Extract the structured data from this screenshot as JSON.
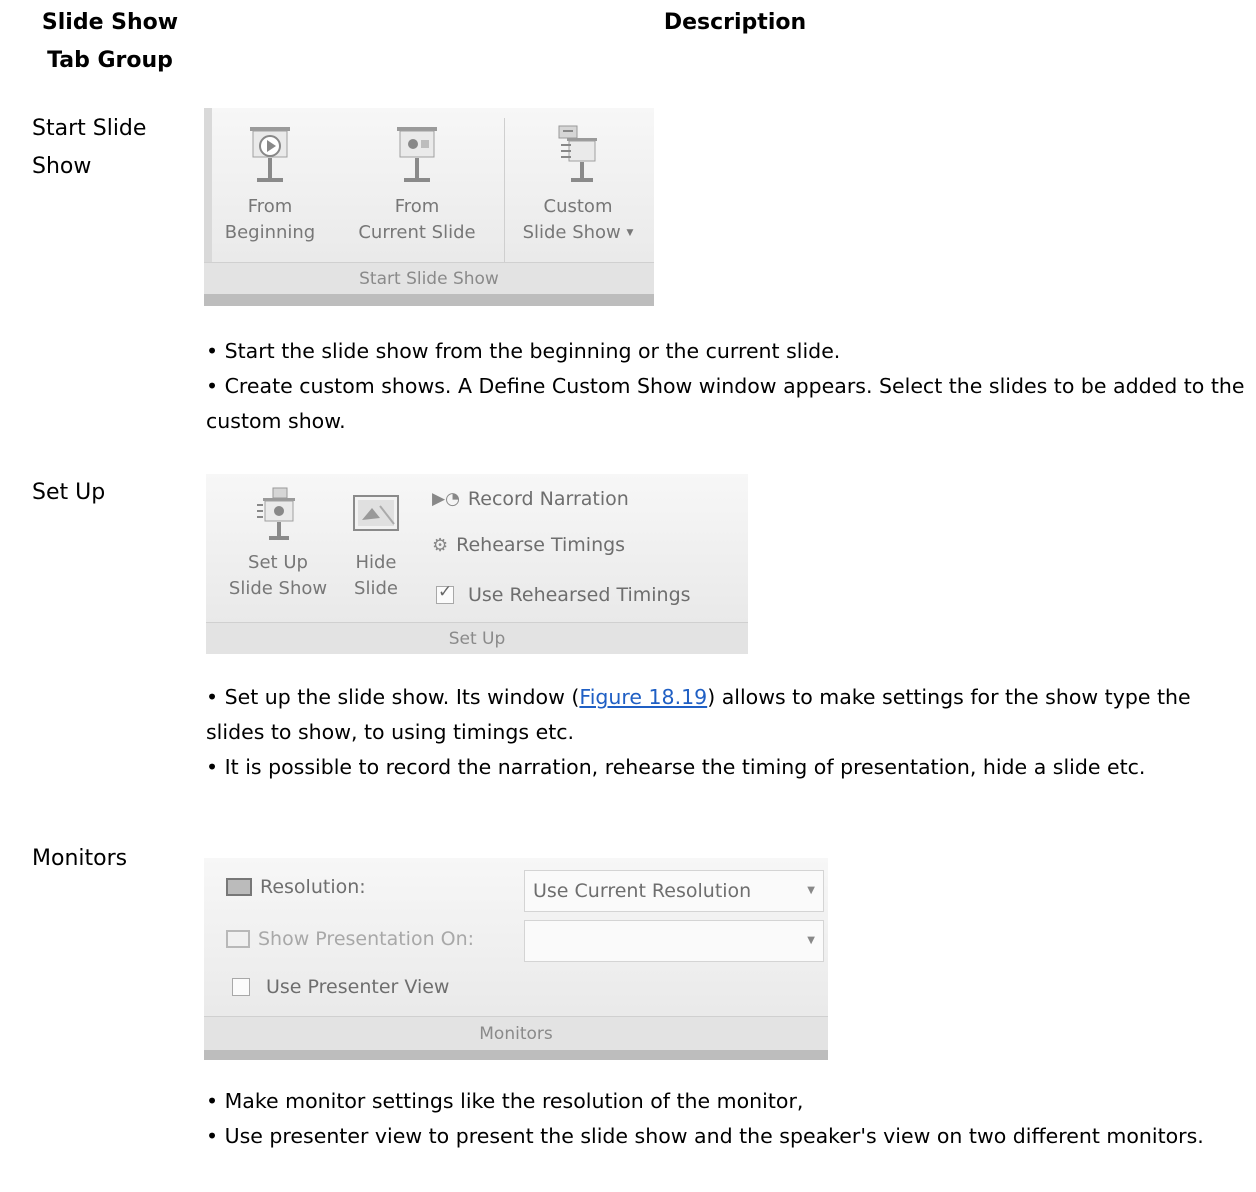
{
  "header": {
    "group_col_line1": "Slide Show",
    "group_col_line2": "Tab Group",
    "desc_col": "Description"
  },
  "rows": {
    "start": {
      "name_line1": "Start Slide",
      "name_line2": "Show",
      "ribbon": {
        "from_beginning_line1": "From",
        "from_beginning_line2": "Beginning",
        "from_current_line1": "From",
        "from_current_line2": "Current Slide",
        "custom_line1": "Custom",
        "custom_line2": "Slide Show",
        "caption": "Start Slide Show"
      },
      "bullets": [
        "• Start the slide show from the beginning or the current slide.",
        "• Create custom shows. A Define Custom Show window appears. Select the slides to be added to the custom show."
      ]
    },
    "setup": {
      "name": "Set Up",
      "ribbon": {
        "setup_line1": "Set Up",
        "setup_line2": "Slide Show",
        "hide_line1": "Hide",
        "hide_line2": "Slide",
        "record": "Record Narration",
        "rehearse": "Rehearse Timings",
        "use_rehearsed": "Use Rehearsed Timings",
        "use_rehearsed_checked": true,
        "caption": "Set Up"
      },
      "bullet1_pre": "• Set up the slide show. Its window (",
      "bullet1_link": "Figure 18.19",
      "bullet1_post": ") allows to make settings for the show type the slides to show, to using timings etc.",
      "bullet2": "• It is possible to record the narration, rehearse the timing of presentation, hide a slide etc."
    },
    "monitors": {
      "name": "Monitors",
      "ribbon": {
        "resolution_label": "Resolution:",
        "resolution_value": "Use Current Resolution",
        "show_on_label": "Show Presentation On:",
        "show_on_value": "",
        "presenter_view": "Use Presenter View",
        "presenter_view_checked": false,
        "caption": "Monitors"
      },
      "bullets": [
        "• Make monitor settings like the resolution of the monitor,",
        "• Use presenter view to present the slide show and the speaker's view on two different monitors."
      ]
    }
  }
}
